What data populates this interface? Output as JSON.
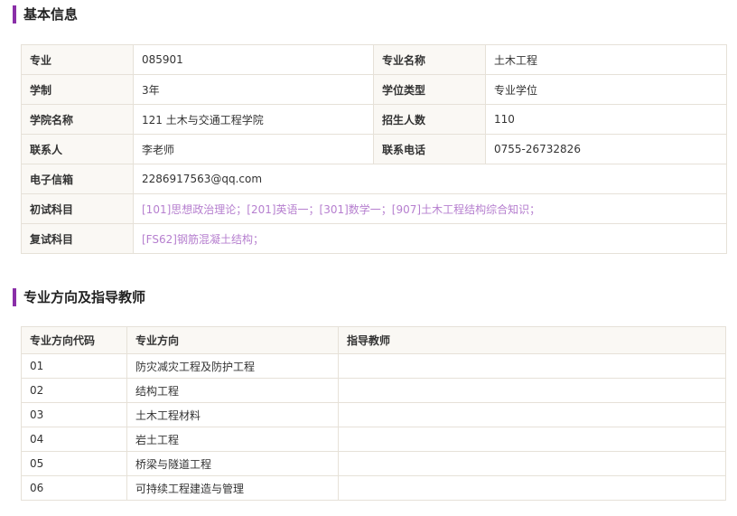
{
  "basic_info": {
    "section_title": "基本信息",
    "major_label": "专业",
    "major_value": "085901",
    "major_name_label": "专业名称",
    "major_name_value": "土木工程",
    "duration_label": "学制",
    "duration_value": "3年",
    "degree_type_label": "学位类型",
    "degree_type_value": "专业学位",
    "college_label": "学院名称",
    "college_value": "121 土木与交通工程学院",
    "enrollment_label": "招生人数",
    "enrollment_value": "110",
    "contact_label": "联系人",
    "contact_value": "李老师",
    "phone_label": "联系电话",
    "phone_value": "0755-26732826",
    "email_label": "电子信箱",
    "email_value": "2286917563@qq.com",
    "prelim_label": "初试科目",
    "prelim_value": "[101]思想政治理论；[201]英语一；[301]数学一；[907]土木工程结构综合知识；",
    "retest_label": "复试科目",
    "retest_value": "[FS62]钢筋混凝土结构；"
  },
  "directions": {
    "section_title": "专业方向及指导教师",
    "headers": {
      "code": "专业方向代码",
      "name": "专业方向",
      "advisor": "指导教师"
    },
    "rows": [
      {
        "code": "01",
        "name": "防灾减灾工程及防护工程",
        "advisor": ""
      },
      {
        "code": "02",
        "name": "结构工程",
        "advisor": ""
      },
      {
        "code": "03",
        "name": "土木工程材料",
        "advisor": ""
      },
      {
        "code": "04",
        "name": "岩土工程",
        "advisor": ""
      },
      {
        "code": "05",
        "name": "桥梁与隧道工程",
        "advisor": ""
      },
      {
        "code": "06",
        "name": "可持续工程建造与管理",
        "advisor": ""
      }
    ]
  }
}
